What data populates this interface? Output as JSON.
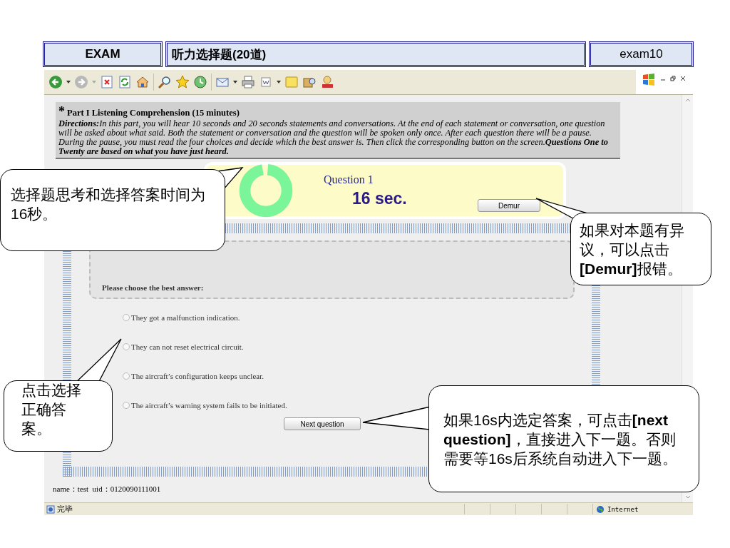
{
  "header": {
    "exam_label": "EXAM",
    "title": "听力选择题(20道)",
    "exam_id": "exam10"
  },
  "instructions": {
    "mark": "*",
    "heading": "Part I  Listening Comprehension (15 minutes)",
    "directions": "**Directions:**In this part, you will hear 10 seconds and 20 seconds statements and conversations. At the end of each statement or conversation, one question will be asked about what said. Both the statement or conversation and the question will be spoken only once.  After each question there will be a pause. During the pause, you must read the four choices and decide which the best answer is. Then click the corresponding button on the screen.**Questions One to Twenty are based on what you have just heard.**"
  },
  "question": {
    "title": "Question 1",
    "timer": "16 sec.",
    "demur_button": "Demur",
    "prompt": "Please choose the best answer:",
    "options": [
      {
        "text": "They got a malfunction indication.",
        "selected": false
      },
      {
        "text": "They can not reset electrical circuit.",
        "selected": false
      },
      {
        "text": "The aircraft’s configuration keeps unclear.",
        "selected": false
      },
      {
        "text": "The aircraft’s warning system fails to be initiated.",
        "selected": false
      }
    ],
    "next_button": "Next question"
  },
  "user_info": "name：test  uid：0120090111001",
  "status_bar": {
    "status": "完毕",
    "zone": "Internet"
  },
  "callouts": [
    {
      "text": "选择题思考和选择答案时间为16秒。"
    },
    {
      "text": "如果对本题有异议，可以点击**[Demur]**报错。"
    },
    {
      "text": "点击选择正确答案。"
    },
    {
      "text": "如果16s内选定答案，可点击**[next question]**，直接进入下一题。否则需要等16s后系统自动进入下一题。"
    }
  ]
}
